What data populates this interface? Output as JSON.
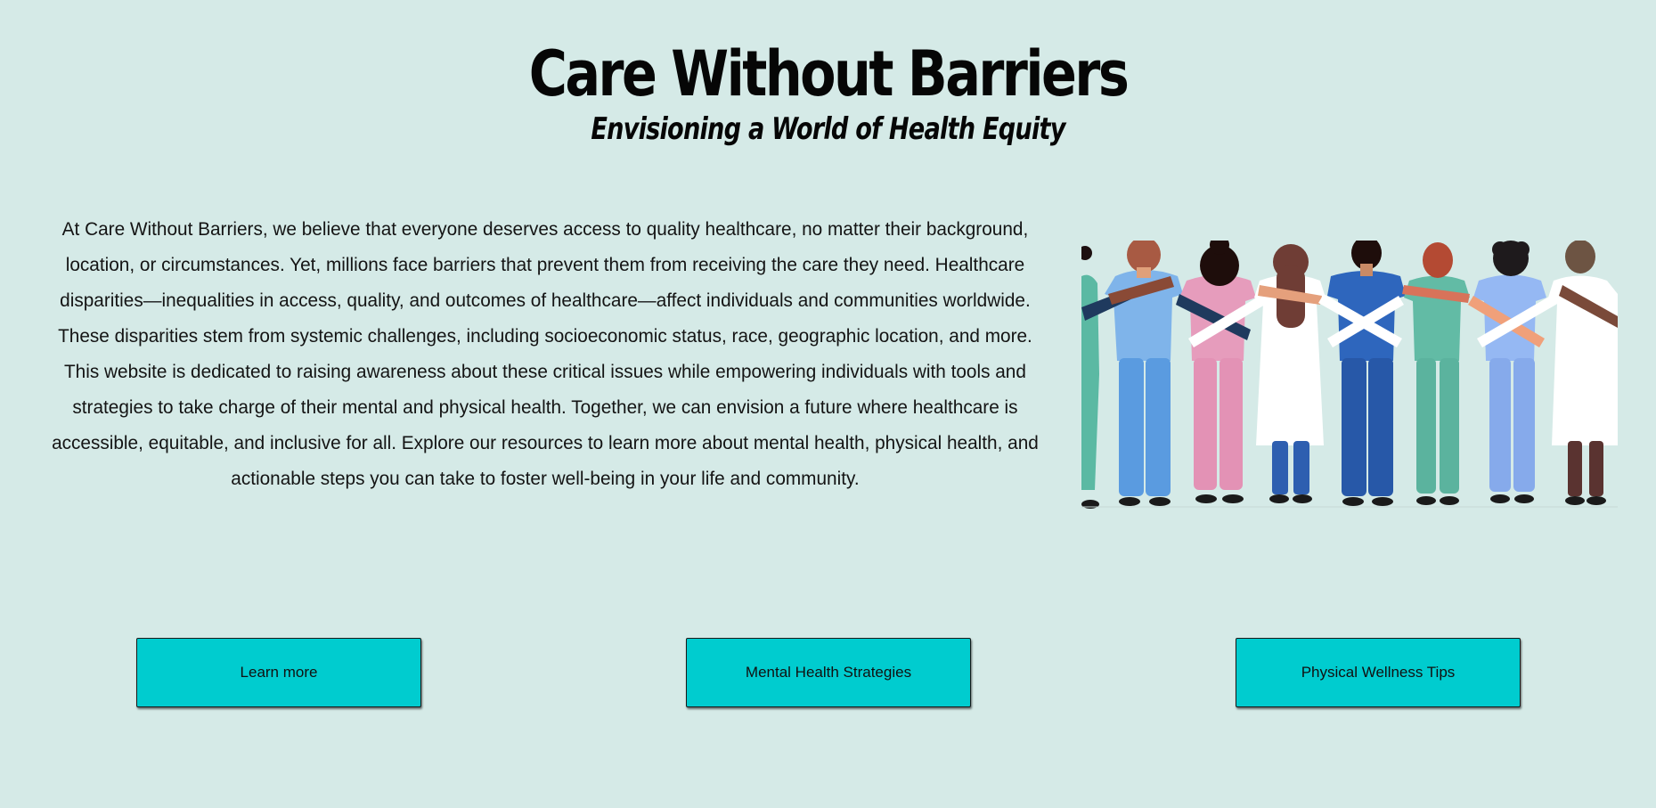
{
  "header": {
    "title": "Care Without Barriers",
    "subtitle": "Envisioning a World of Health Equity"
  },
  "intro": {
    "text": "At Care Without Barriers, we believe that everyone deserves access to quality healthcare, no matter their background, location, or circumstances. Yet, millions face barriers that prevent them from receiving the care they need. Healthcare disparities—inequalities in access, quality, and outcomes of healthcare—affect individuals and communities worldwide. These disparities stem from systemic challenges, including socioeconomic status, race, geographic location, and more. This website is dedicated to raising awareness about these critical issues while empowering individuals with tools and strategies to take charge of their mental and physical health. Together, we can envision a future where healthcare is accessible, equitable, and inclusive for all. Explore our resources to learn more about mental health, physical health, and actionable steps you can take to foster well-being in your life and community."
  },
  "illustration": {
    "icon": "diverse-healthcare-workers-arm-in-arm-illustration"
  },
  "buttons": {
    "learn_more": "Learn more",
    "mental_health": "Mental Health Strategies",
    "physical_wellness": "Physical Wellness Tips"
  },
  "colors": {
    "background": "#d5eae7",
    "button": "#00cccf",
    "text": "#111111"
  }
}
